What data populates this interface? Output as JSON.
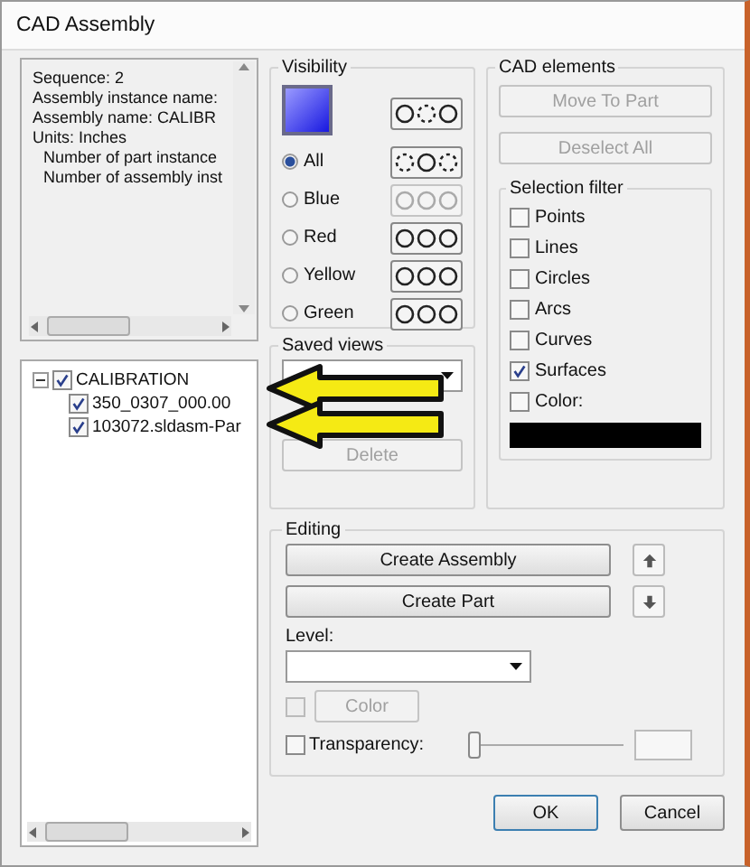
{
  "window": {
    "title": "CAD Assembly"
  },
  "info": {
    "lines": [
      {
        "text": "Sequence: 2"
      },
      {
        "text": "Assembly instance name:"
      },
      {
        "text": "Assembly name: CALIBR"
      },
      {
        "text": "Units: Inches",
        "children": [
          {
            "text": "Number of part instance"
          },
          {
            "text": "Number of assembly inst"
          }
        ]
      }
    ]
  },
  "tree": [
    {
      "label": "CALIBRATION",
      "checked": true,
      "expanded": true,
      "children": [
        {
          "label": "350_0307_000.00",
          "checked": true
        },
        {
          "label": "103072.sldasm-Par",
          "checked": true
        }
      ]
    }
  ],
  "visibility": {
    "title": "Visibility",
    "top_button": {
      "kind": "alternate",
      "disabled": false
    },
    "options": [
      {
        "label": "All",
        "selected": true,
        "button": {
          "kind": "inverse",
          "disabled": false
        }
      },
      {
        "label": "Blue",
        "selected": false,
        "button": {
          "kind": "plain",
          "disabled": true
        }
      },
      {
        "label": "Red",
        "selected": false,
        "button": {
          "kind": "plain",
          "disabled": false
        }
      },
      {
        "label": "Yellow",
        "selected": false,
        "button": {
          "kind": "plain",
          "disabled": false
        }
      },
      {
        "label": "Green",
        "selected": false,
        "button": {
          "kind": "plain",
          "disabled": false
        }
      }
    ]
  },
  "saved_views": {
    "title": "Saved views",
    "delete_button": {
      "label": "Delete",
      "disabled": true
    }
  },
  "cad_elements": {
    "title": "CAD elements",
    "buttons": [
      {
        "label": "Move To Part",
        "disabled": true
      },
      {
        "label": "Deselect All",
        "disabled": true
      }
    ],
    "selection_filter": {
      "title": "Selection filter",
      "items": [
        {
          "label": "Points",
          "checked": false
        },
        {
          "label": "Lines",
          "checked": false
        },
        {
          "label": "Circles",
          "checked": false
        },
        {
          "label": "Arcs",
          "checked": false
        },
        {
          "label": "Curves",
          "checked": false
        },
        {
          "label": "Surfaces",
          "checked": true
        },
        {
          "label": "Color:",
          "checked": false
        }
      ]
    }
  },
  "editing": {
    "title": "Editing",
    "buttons": [
      {
        "label": "Create Assembly"
      },
      {
        "label": "Create Part"
      }
    ],
    "level_label": "Level:",
    "color": {
      "label": "Color",
      "checked": false,
      "disabled": true
    },
    "transparency": {
      "label": "Transparency:",
      "checked": false,
      "level": 0
    }
  },
  "footer": [
    {
      "label": "OK"
    },
    {
      "label": "Cancel"
    }
  ]
}
